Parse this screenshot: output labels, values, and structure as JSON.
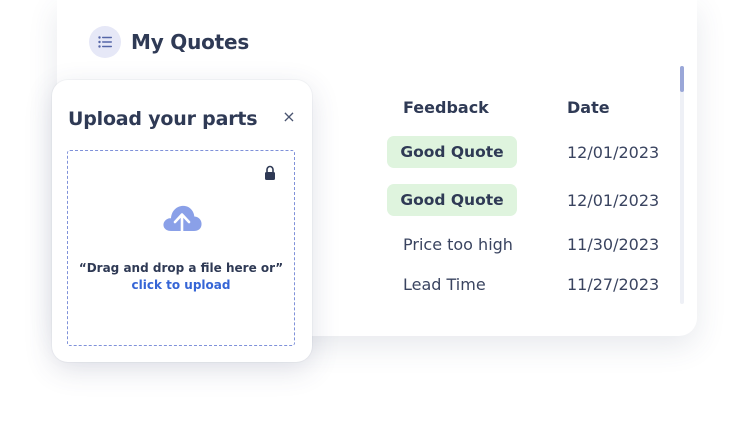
{
  "quotes": {
    "title": "My Quotes",
    "columns": {
      "feedback": "Feedback",
      "date": "Date"
    },
    "rows": [
      {
        "feedback": "Good Quote",
        "date": "12/01/2023",
        "badge": true
      },
      {
        "feedback": "Good Quote",
        "date": "12/01/2023",
        "badge": true
      },
      {
        "feedback": "Price too high",
        "date": "11/30/2023",
        "badge": false
      },
      {
        "feedback": "Lead Time",
        "date": "11/27/2023",
        "badge": false
      }
    ]
  },
  "upload": {
    "title": "Upload your parts",
    "close_label": "×",
    "drag_text": "“Drag and drop a file here or”",
    "click_text": "click to upload"
  },
  "colors": {
    "accent": "#3565d6",
    "badge_bg": "#dff4de",
    "cloud": "#8aa0e8",
    "text": "#2f3a55"
  },
  "icons": [
    "list-icon",
    "close-icon",
    "lock-icon",
    "cloud-upload-icon"
  ]
}
